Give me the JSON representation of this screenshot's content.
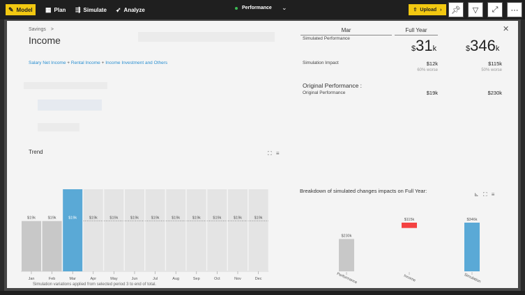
{
  "toolbar": {
    "tabs": [
      {
        "label": "Model",
        "icon": "pencil-icon"
      },
      {
        "label": "Plan",
        "icon": "calendar-icon"
      },
      {
        "label": "Simulate",
        "icon": "simulate-icon"
      },
      {
        "label": "Analyze",
        "icon": "analyze-icon"
      }
    ],
    "view_label": "Performance",
    "upload_label": "Upload",
    "colors": {
      "accent": "#f2c811",
      "status": "#3cba54"
    }
  },
  "header": {
    "breadcrumb": "Savings",
    "breadcrumb_sep": ">",
    "title": "Income",
    "formula": [
      "Salary Net Income",
      "Rental Income",
      "Income Investment and Others"
    ],
    "formula_sep": "+"
  },
  "kpi": {
    "col_mar": "Mar",
    "col_fy": "Full Year",
    "simulated_label": "Simulated Performance",
    "sim_mar_prefix": "$",
    "sim_mar_num": "31",
    "sim_mar_suffix": "k",
    "sim_fy_prefix": "$",
    "sim_fy_num": "346",
    "sim_fy_suffix": "k",
    "impact_label": "Simulation Impact",
    "impact_mar": "$12k",
    "impact_mar_note": "60% worse",
    "impact_fy": "$115k",
    "impact_fy_note": "50% worse",
    "original_title": "Original Performance :",
    "original_label": "Original Performance",
    "original_mar": "$19k",
    "original_fy": "$230k"
  },
  "trend": {
    "title": "Trend",
    "footnote": "Simulation variations applied from selected period 3 to end of total."
  },
  "breakdown": {
    "title": "Breakdown of simulated changes impacts on Full Year:"
  },
  "chart_data": [
    {
      "type": "bar",
      "title": "Trend",
      "categories": [
        "Jan",
        "Feb",
        "Mar",
        "Apr",
        "May",
        "Jun",
        "Jul",
        "Aug",
        "Sep",
        "Oct",
        "Nov",
        "Dec"
      ],
      "values": [
        19,
        19,
        19,
        19,
        19,
        19,
        19,
        19,
        19,
        19,
        19,
        19
      ],
      "labels": [
        "$19k",
        "$19k",
        "$19k",
        "$19k",
        "$19k",
        "$19k",
        "$19k",
        "$19k",
        "$19k",
        "$19k",
        "$19k",
        "$19k"
      ],
      "sim_values": [
        19,
        19,
        31,
        31,
        31,
        31,
        31,
        31,
        31,
        31,
        31,
        31
      ],
      "selected": "Mar",
      "colors": {
        "actual": "#c8c8c8",
        "selected": "#5aa9d6",
        "simulated": "#e4e4e4"
      }
    },
    {
      "type": "bar",
      "title": "Breakdown of simulated changes impacts on Full Year:",
      "categories": [
        "Performance",
        "Income",
        "Simulation"
      ],
      "values": [
        230,
        115,
        346
      ],
      "labels": [
        "$230k",
        "$115k",
        "$346k"
      ],
      "colors": [
        "#c8c8c8",
        "#f44242",
        "#5aa9d6"
      ]
    }
  ]
}
